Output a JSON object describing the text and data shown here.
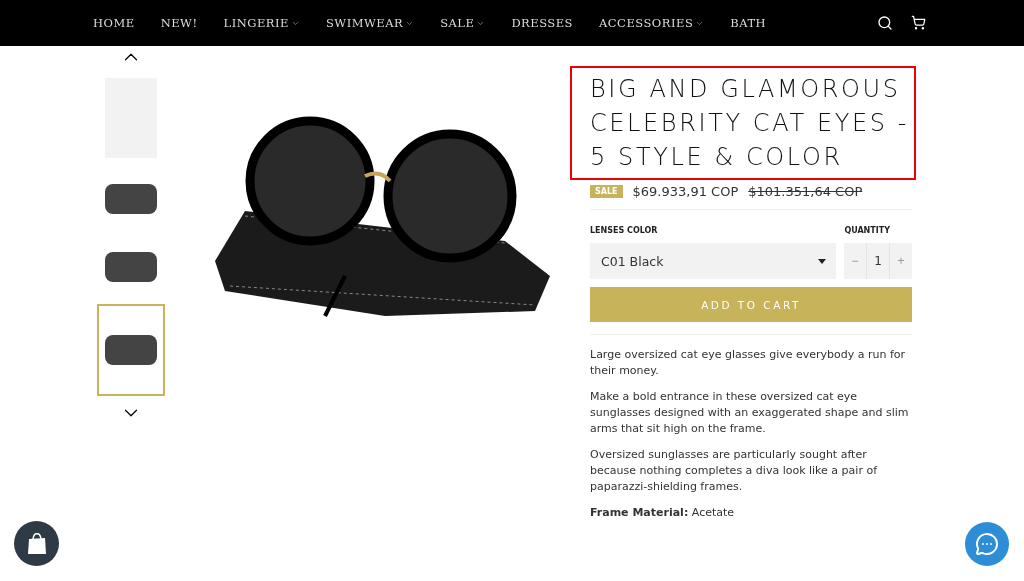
{
  "nav": {
    "items": [
      {
        "label": "HOME",
        "dropdown": false
      },
      {
        "label": "NEW!",
        "dropdown": false
      },
      {
        "label": "LINGERIE",
        "dropdown": true
      },
      {
        "label": "SWIMWEAR",
        "dropdown": true
      },
      {
        "label": "SALE",
        "dropdown": true
      },
      {
        "label": "DRESSES",
        "dropdown": false
      },
      {
        "label": "ACCESSORIES",
        "dropdown": true
      },
      {
        "label": "BATH",
        "dropdown": false
      }
    ]
  },
  "gallery": {
    "thumbnails": [
      {
        "selected": false
      },
      {
        "selected": false
      },
      {
        "selected": false
      },
      {
        "selected": true
      }
    ]
  },
  "product": {
    "title": "BIG AND GLAMOROUS CELEBRITY CAT EYES - 5 STYLE & COLOR",
    "highlighted": true,
    "badge": "SALE",
    "price": "$69.933,91 COP",
    "compare_price": "$101.351,64 COP",
    "option_label": "LENSES COLOR",
    "option_value": "C01 Black",
    "quantity_label": "QUANTITY",
    "quantity_minus": "−",
    "quantity": "1",
    "quantity_plus": "+",
    "add_to_cart": "ADD TO CART",
    "description": [
      "Large oversized cat eye glasses give everybody a run for their money.",
      "Make a bold entrance in these oversized cat eye sunglasses designed with an exaggerated shape and slim arms that sit high on the frame.",
      "Oversized sunglasses are particularly sought after because nothing completes a diva look like a pair of paparazzi-shielding frames.",
      "**Frame Material:** Acetate"
    ]
  }
}
